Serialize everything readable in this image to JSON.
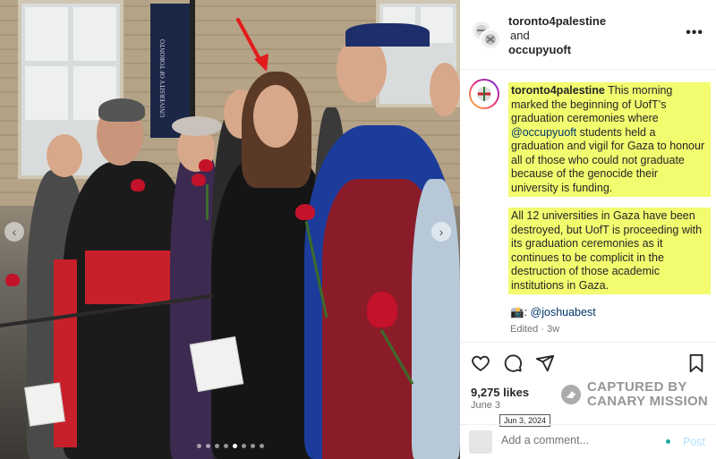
{
  "header": {
    "user1": "toronto4palestine",
    "and": "and",
    "user2": "occupyuoft",
    "more_label": "•••"
  },
  "photo": {
    "banner_text": "UNIVERSITY OF TORONTO",
    "carousel_total": 8,
    "carousel_active": 5
  },
  "caption": {
    "username": "toronto4palestine",
    "p1_a": " This morning marked the beginning of UofT’s graduation ceremonies where ",
    "p1_mention": "@occupyuoft",
    "p1_b": " students held a graduation and vigil for Gaza to honour all of those who could not graduate because of the genocide their university is funding.",
    "p2": "All 12 universities in Gaza have been destroyed, but UofT is proceeding with its graduation ceremonies as it continues to be complicit in the destruction of those academic institutions in Gaza.",
    "credit_emoji": "📸",
    "credit_sep": ": ",
    "credit_mention": "@joshuabest",
    "edited": "Edited · 3w"
  },
  "actions": {
    "likes": "9,275 likes",
    "date": "June 3",
    "tooltip": "Jun 3, 2024",
    "watermark_line1": "CAPTURED BY",
    "watermark_line2": "CANARY MISSION"
  },
  "add_comment": {
    "placeholder": "Add a comment...",
    "post_label": "Post"
  },
  "colors": {
    "highlight": "#f3fb6f",
    "mention": "#00376b",
    "post_disabled": "#b2dffc"
  }
}
